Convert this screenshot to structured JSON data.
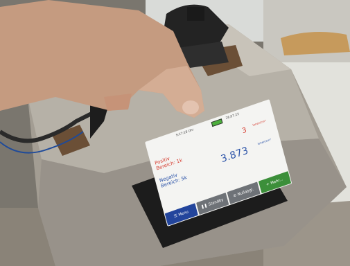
{
  "status": {
    "time": "9:17:18 Uhr",
    "date": "26.07.23"
  },
  "readings": {
    "mode_label": "Positiv",
    "range_top": "Bereich: 1k",
    "mode_label_2": "Negativ",
    "range_bottom": "Bereich: 5k",
    "value_top": "3",
    "unit_top": "Ionen/cm³",
    "value_main": "3.873",
    "unit_main": "Ionen/cm³"
  },
  "buttons": {
    "menu": "Menu",
    "standby": "Standby",
    "nullabgl": "Nullabgl.",
    "more": "Mehr..."
  },
  "colors": {
    "positive": "#d63a2e",
    "negative": "#2a52a8",
    "menu": "#23459c",
    "more": "#3c8f3a"
  }
}
